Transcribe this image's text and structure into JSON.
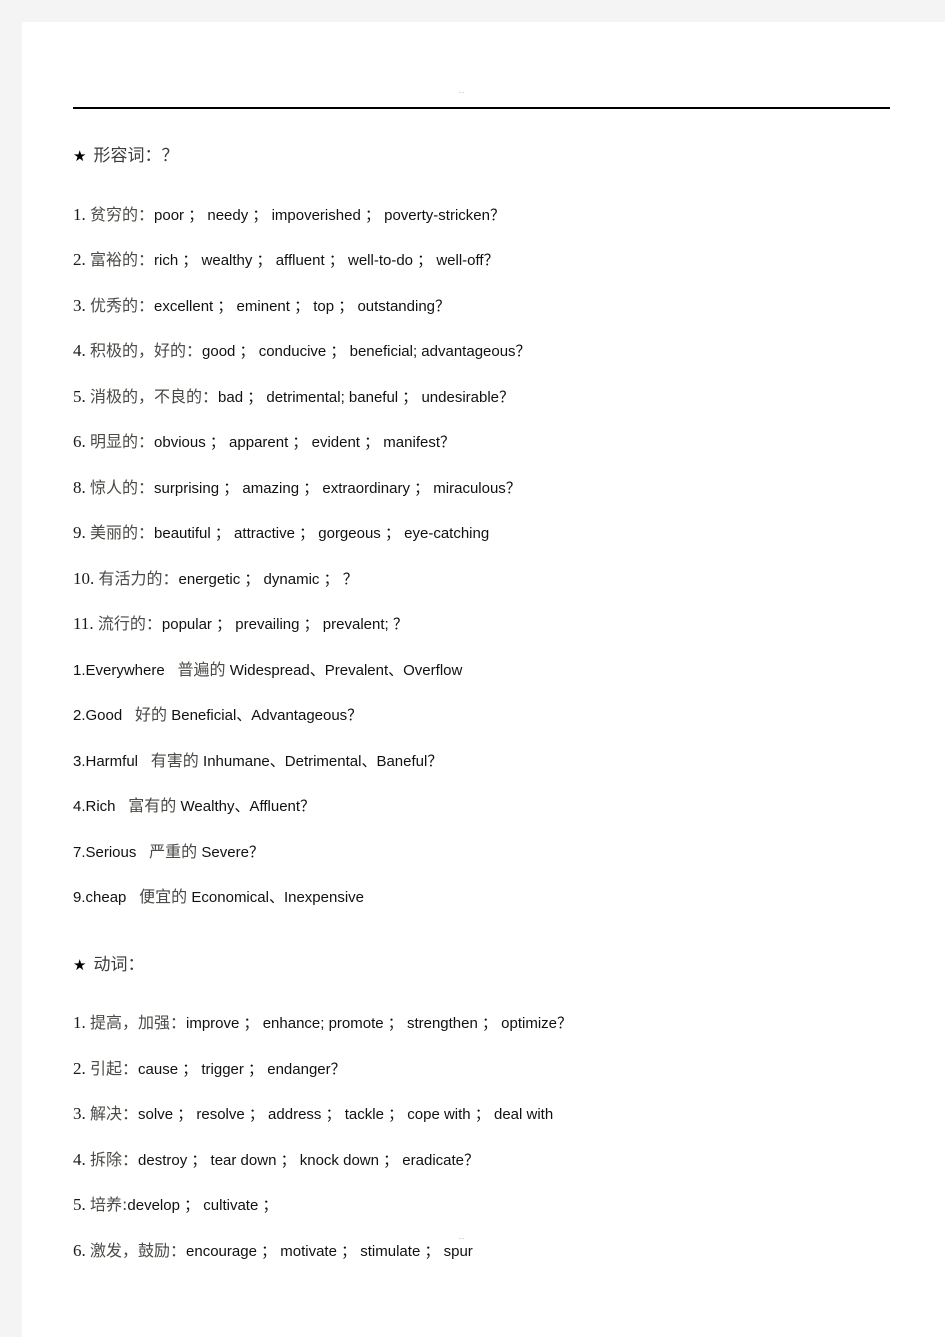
{
  "page": {
    "header_mark": "..",
    "footer_mark": "..",
    "rule_color": "#000000",
    "background": "#ffffff",
    "outside_background": "#f4f4f4"
  },
  "sections": [
    {
      "name": "adjectives",
      "star": "★",
      "heading": "形容词：？",
      "entries": [
        {
          "num": "1.",
          "cn": "贫穷的：",
          "en": "poor ；     needy ；     impoverished ；     poverty-stricken？"
        },
        {
          "num": "2.",
          "cn": "富裕的：",
          "en": "rich ；     wealthy ；     affluent ；     well-to-do ；     well-off？"
        },
        {
          "num": "3.",
          "cn": "优秀的：",
          "en": "excellent ；     eminent ；     top ；     outstanding？"
        },
        {
          "num": "4.",
          "cn": "积极的，好的：",
          "en": "good ；     conducive ；     beneficial;     advantageous？"
        },
        {
          "num": "5.",
          "cn": "消极的，不良的：",
          "en": "bad ；     detrimental;     baneful ；   undesirable？"
        },
        {
          "num": "6.",
          "cn": "明显的：",
          "en": "obvious ；     apparent ；     evident ；   manifest？"
        },
        {
          "num": "8.",
          "cn": "惊人的：",
          "en": "surprising ；     amazing ；     extraordinary ；     miraculous？"
        },
        {
          "num": "9.",
          "cn": "美丽的：",
          "en": "beautiful ；     attractive ；     gorgeous ；     eye-catching"
        },
        {
          "num": "10.",
          "cn": "有活力的：",
          "en": "energetic ；     dynamic ；     ？"
        },
        {
          "num": "11.",
          "cn": "流行的：",
          "en": "popular ；     prevailing ；     prevalent;   ？"
        }
      ],
      "subentries": [
        {
          "num": "1.Everywhere",
          "cn": "普遍的",
          "en": "Widespread、Prevalent、Overflow"
        },
        {
          "num": "2.Good",
          "cn": "好的",
          "en": "Beneficial、Advantageous？"
        },
        {
          "num": "3.Harmful",
          "cn": "有害的",
          "en": "Inhumane、Detrimental、Baneful？"
        },
        {
          "num": "4.Rich",
          "cn": "富有的",
          "en": "Wealthy、Affluent？"
        },
        {
          "num": "7.Serious",
          "cn": "严重的",
          "en": "Severe？"
        },
        {
          "num": "9.cheap",
          "cn": "便宜的",
          "en": "Economical、Inexpensive"
        }
      ]
    },
    {
      "name": "verbs",
      "star": "★",
      "heading": "动词：",
      "entries": [
        {
          "num": "1.",
          "cn": "提高，加强：",
          "en": "improve ；     enhance;     promote ；     strengthen ；     optimize？"
        },
        {
          "num": "2.",
          "cn": "引起：",
          "en": "cause ；     trigger ；     endanger？"
        },
        {
          "num": "3.",
          "cn": "解决：",
          "en": "solve ；   resolve ；   address ；     tackle ；   cope with ；     deal with"
        },
        {
          "num": "4.",
          "cn": "拆除：",
          "en": "destroy ；     tear down ；     knock down ；     eradicate？"
        },
        {
          "num": "5.",
          "cn": "培养:",
          "en": "develop ；     cultivate ；"
        },
        {
          "num": "6.",
          "cn": "激发，鼓励：",
          "en": "encourage ；     motivate ；     stimulate ；     spur"
        }
      ],
      "subentries": []
    }
  ]
}
